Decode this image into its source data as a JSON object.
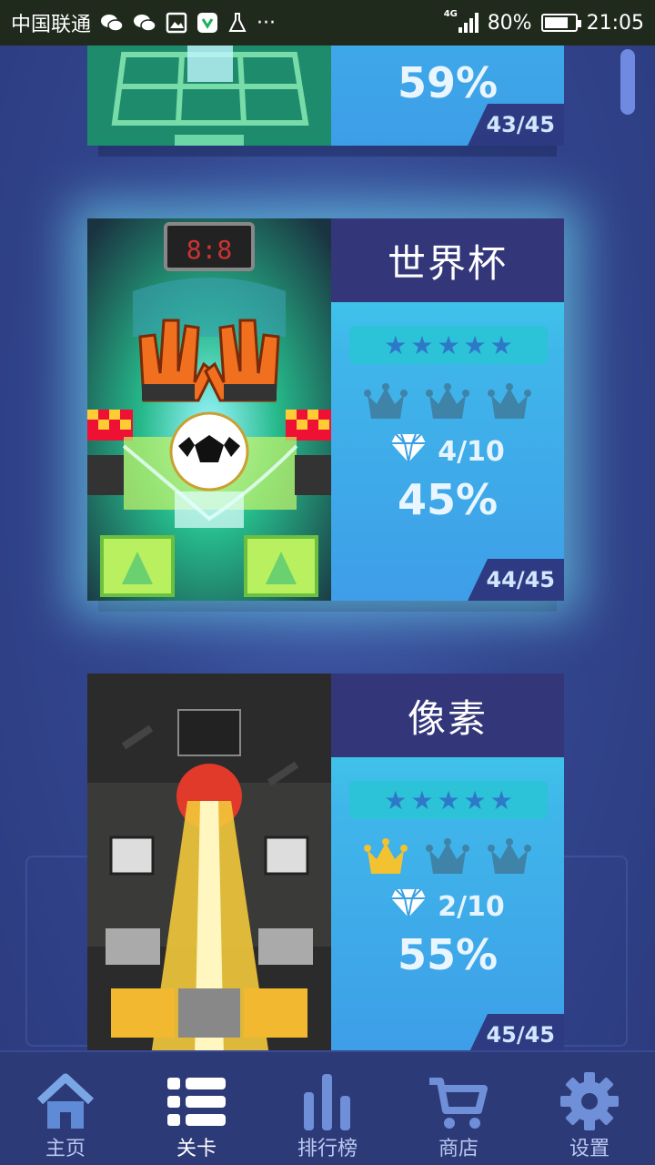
{
  "status_bar": {
    "carrier": "中国联通",
    "battery": "80%",
    "battery_level": 0.8,
    "time": "21:05",
    "network": "4G",
    "more": "···"
  },
  "levels": [
    {
      "title": "",
      "stars": 5,
      "crowns_earned": 0,
      "gems": "",
      "percent": "59%",
      "progress": "43/45"
    },
    {
      "title": "世界杯",
      "stars": 5,
      "crowns_earned": 0,
      "gems": "4/10",
      "percent": "45%",
      "progress": "44/45"
    },
    {
      "title": "像素",
      "stars": 5,
      "crowns_earned": 1,
      "gems": "2/10",
      "percent": "55%",
      "progress": "45/45"
    }
  ],
  "nav": [
    {
      "label": "主页",
      "icon": "home-icon"
    },
    {
      "label": "关卡",
      "icon": "list-icon"
    },
    {
      "label": "排行榜",
      "icon": "bar-chart-icon"
    },
    {
      "label": "商店",
      "icon": "cart-icon"
    },
    {
      "label": "设置",
      "icon": "gear-icon"
    }
  ],
  "colors": {
    "crown_earned": "#f2c230",
    "crown_empty": "#3f83a8",
    "star": "#2e78c8",
    "accent_glow": "#78f0ff"
  }
}
